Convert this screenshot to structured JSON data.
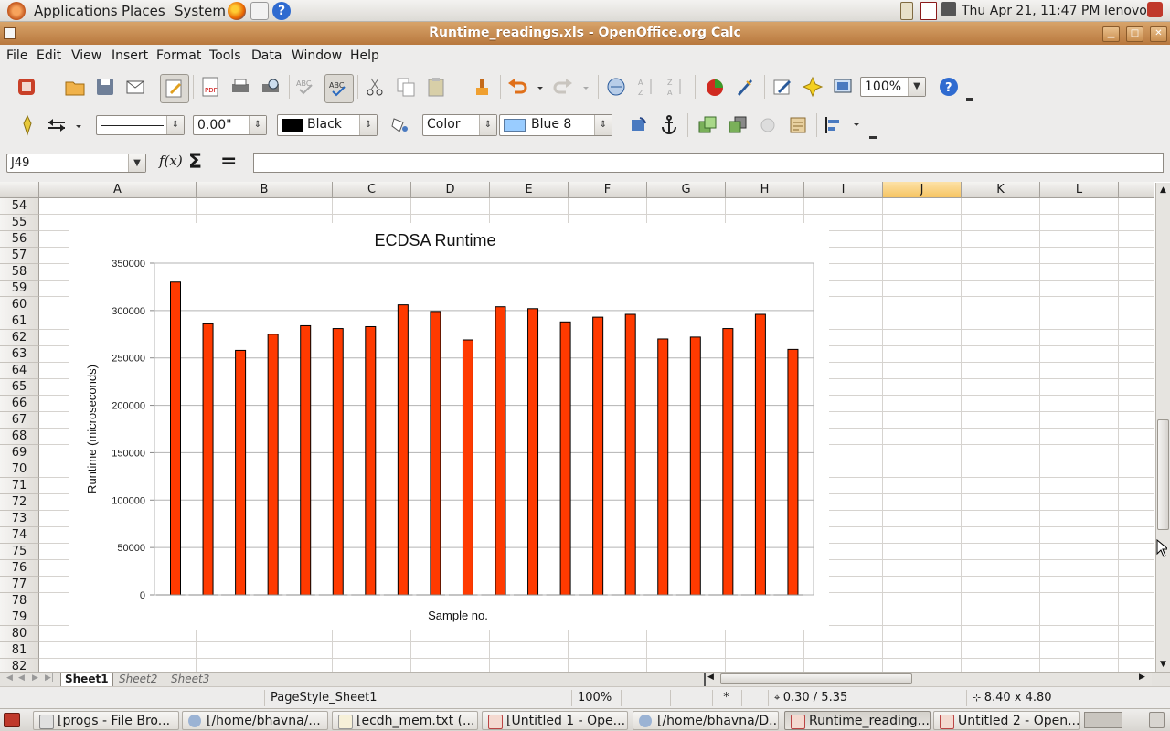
{
  "panel": {
    "applications": "Applications",
    "places": "Places",
    "system": "System",
    "datetime": "Thu Apr 21, 11:47 PM",
    "user": "lenovo"
  },
  "window": {
    "title": "Runtime_readings.xls - OpenOffice.org Calc"
  },
  "menu": [
    "File",
    "Edit",
    "View",
    "Insert",
    "Format",
    "Tools",
    "Data",
    "Window",
    "Help"
  ],
  "toolbar": {
    "zoom": "100%"
  },
  "drawbar": {
    "line_width": "0.00\"",
    "line_color": "Black",
    "area_style": "Color",
    "area_color": "Blue 8",
    "line_color_hex": "#000000",
    "area_color_hex": "#99ccff"
  },
  "formula": {
    "name_box": "J49",
    "value": ""
  },
  "grid": {
    "columns": [
      "A",
      "B",
      "C",
      "D",
      "E",
      "F",
      "G",
      "H",
      "I",
      "J",
      "K",
      "L"
    ],
    "active_column": "J",
    "rows": [
      "54",
      "55",
      "56",
      "57",
      "58",
      "59",
      "60",
      "61",
      "62",
      "63",
      "64",
      "65",
      "66",
      "67",
      "68",
      "69",
      "70",
      "71",
      "72",
      "73",
      "74",
      "75",
      "76",
      "77",
      "78",
      "79",
      "80",
      "81",
      "82"
    ]
  },
  "chart_data": {
    "type": "bar",
    "title": "ECDSA Runtime",
    "xlabel": "Sample no.",
    "ylabel": "Runtime (microseconds)",
    "ylim": [
      0,
      350000
    ],
    "yticks": [
      "0",
      "50000",
      "100000",
      "150000",
      "200000",
      "250000",
      "300000",
      "350000"
    ],
    "grid": true,
    "legend": "none",
    "bar_color": "#ff3a00",
    "values": [
      330000,
      286000,
      258000,
      275000,
      284000,
      281000,
      283000,
      306000,
      299000,
      269000,
      304000,
      302000,
      288000,
      293000,
      296000,
      270000,
      272000,
      281000,
      296000,
      259000
    ]
  },
  "sheets": [
    "Sheet1",
    "Sheet2",
    "Sheet3"
  ],
  "status": {
    "page_style": "PageStyle_Sheet1",
    "zoom": "100%",
    "modified": "*",
    "position": "0.30 / 5.35",
    "size": "8.40 x 4.80"
  },
  "taskbar": [
    "[progs - File Bro...",
    "[/home/bhavna/...",
    "[ecdh_mem.txt (...",
    "[Untitled 1 - Ope...",
    "[/home/bhavna/D...",
    "Runtime_reading...",
    "Untitled 2 - Open..."
  ]
}
